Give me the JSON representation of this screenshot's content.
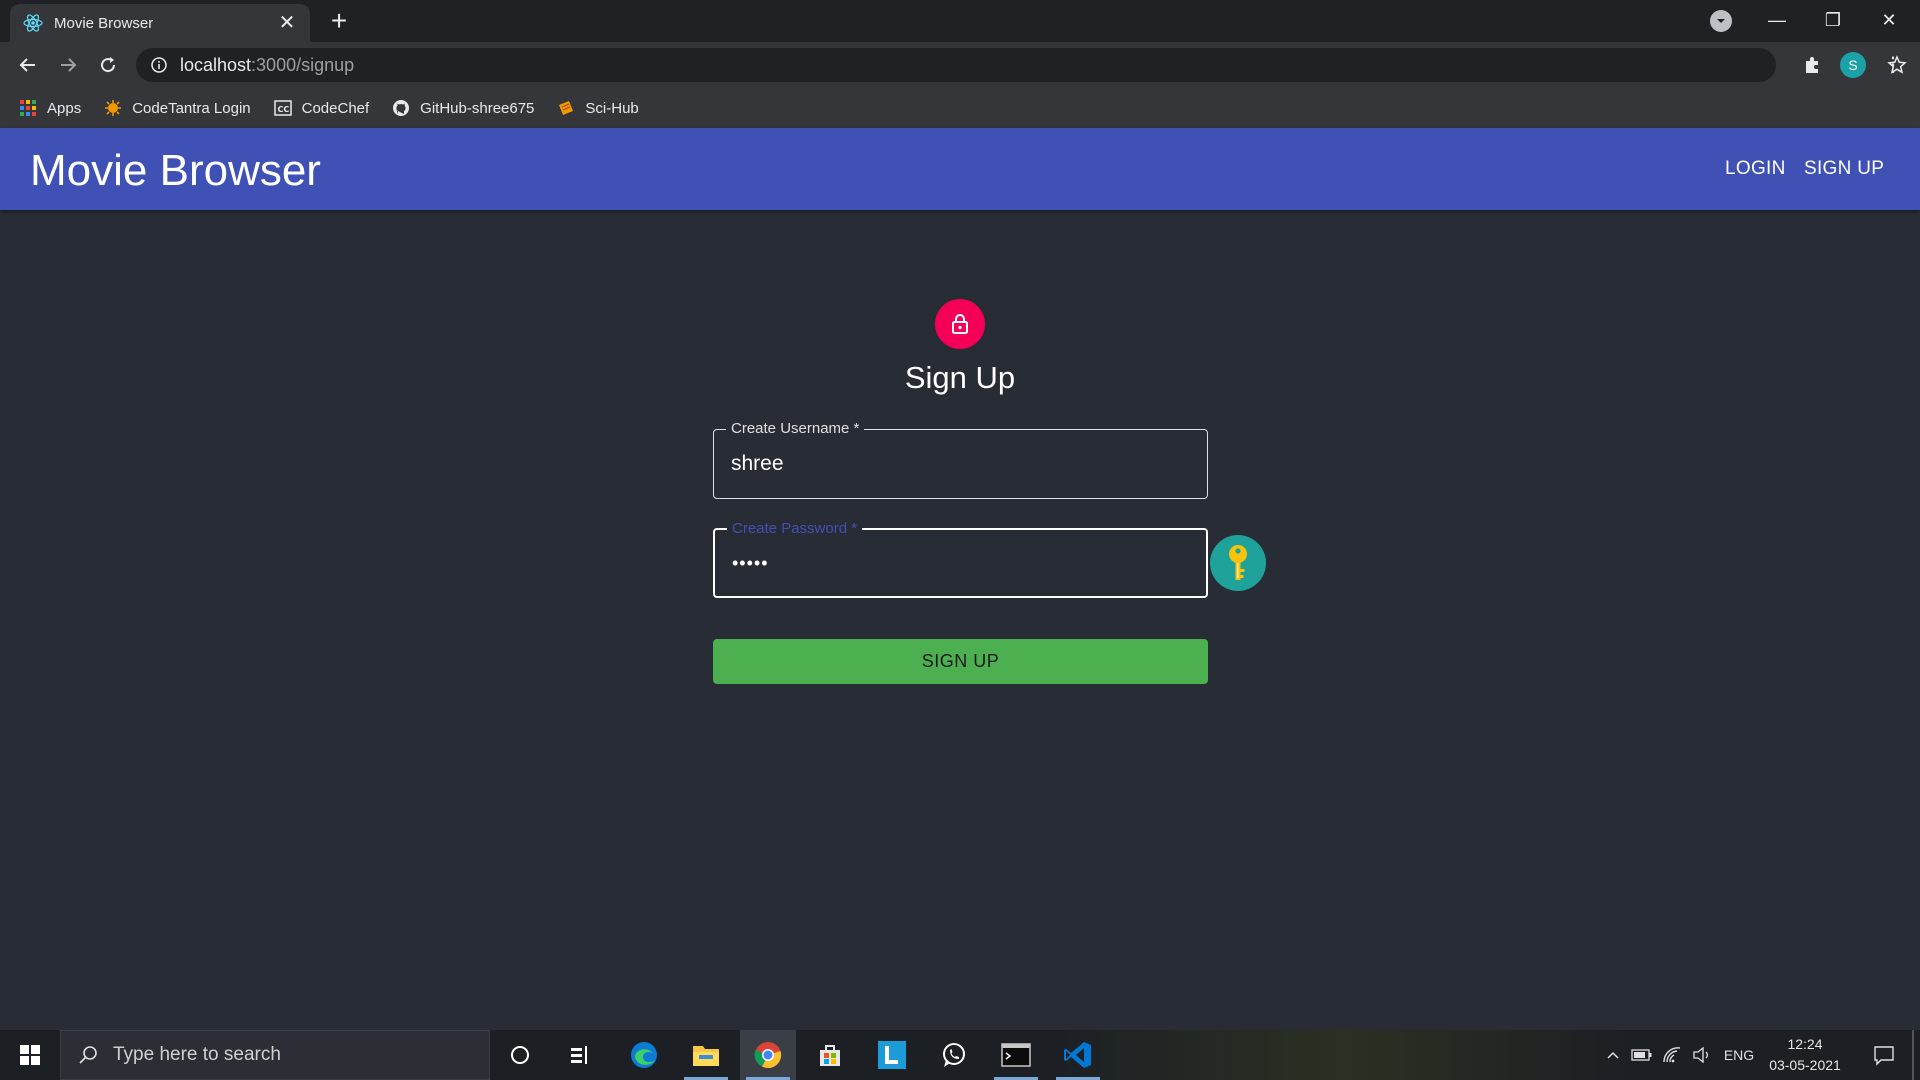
{
  "browser": {
    "tab_title": "Movie Browser",
    "url_host": "localhost",
    "url_path": ":3000/signup",
    "avatar_letter": "S"
  },
  "bookmarks": [
    {
      "label": "Apps",
      "icon": "apps-grid-icon"
    },
    {
      "label": "CodeTantra Login",
      "icon": "codetantra-icon"
    },
    {
      "label": "CodeChef",
      "icon": "codechef-icon"
    },
    {
      "label": "GitHub-shree675",
      "icon": "github-icon"
    },
    {
      "label": "Sci-Hub",
      "icon": "scihub-icon"
    }
  ],
  "appbar": {
    "title": "Movie Browser",
    "nav": {
      "login": "LOGIN",
      "signup": "SIGN UP"
    },
    "color": "#3f51b5"
  },
  "form": {
    "heading": "Sign Up",
    "username": {
      "label": "Create Username *",
      "value": "shree"
    },
    "password": {
      "label": "Create Password *",
      "value": "•••••"
    },
    "submit_label": "SIGN UP",
    "lock_color": "#f50057",
    "key_button_color": "#1ea29a",
    "submit_color": "#4caf50"
  },
  "taskbar": {
    "search_placeholder": "Type here to search",
    "language": "ENG",
    "time": "12:24",
    "date": "03-05-2021",
    "apps": [
      "cortana-icon",
      "task-view-icon",
      "edge-icon",
      "file-explorer-icon",
      "chrome-icon",
      "store-icon",
      "l-app-icon",
      "whatsapp-icon",
      "terminal-icon",
      "vscode-icon"
    ]
  }
}
